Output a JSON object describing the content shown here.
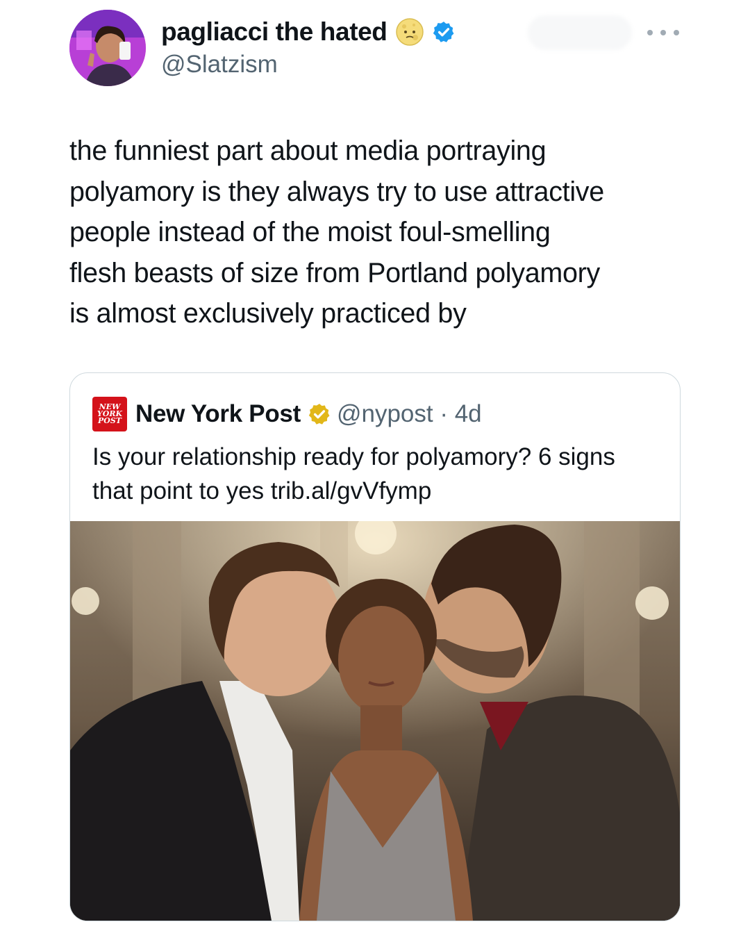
{
  "post": {
    "author": {
      "display_name": "pagliacci the hated",
      "handle": "@Slatzism",
      "avatar_icon": "profile-photo-avatar",
      "name_emoji": "moon-face-emoji",
      "verified": true,
      "verified_color": "#1d9bf0"
    },
    "text": "the funniest part about media portraying\npolyamory is they always try to use attractive\npeople instead of the moist foul-smelling\nflesh beasts of size from Portland polyamory\nis almost exclusively practiced by",
    "more_icon": "more-options-icon"
  },
  "quoted": {
    "logo_lines": [
      "NEW",
      "YORK",
      "POST"
    ],
    "logo_color": "#d4121a",
    "name": "New York Post",
    "badge_color": "#e2b719",
    "handle_time": "@nypost · 4d",
    "text": "Is your relationship ready for polyamory? 6 signs\nthat point to yes trib.al/gvVfymp",
    "image_icon": "article-photo"
  }
}
